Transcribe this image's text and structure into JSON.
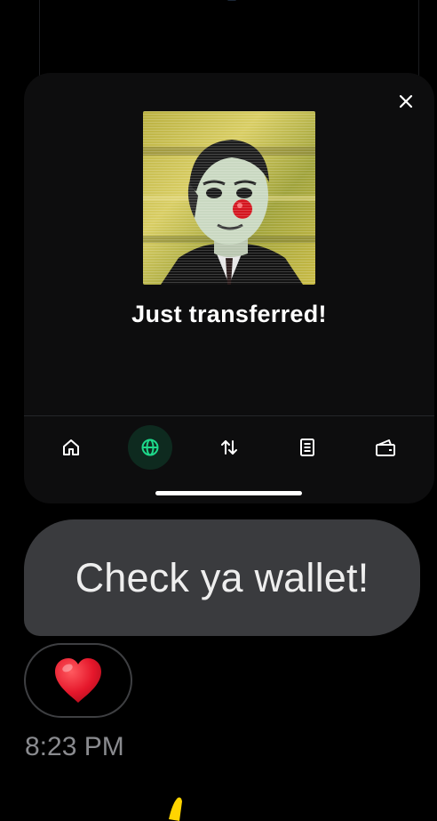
{
  "notification_card": {
    "close_icon": "close-icon",
    "image_alt": "NFT artwork of a man in a suit with a red clown nose",
    "title": "Just transferred!"
  },
  "bottom_nav": {
    "items": [
      {
        "icon": "home-icon",
        "active": false
      },
      {
        "icon": "globe-icon",
        "active": true
      },
      {
        "icon": "transfer-arrows-icon",
        "active": false
      },
      {
        "icon": "document-icon",
        "active": false
      },
      {
        "icon": "wallet-icon",
        "active": false
      }
    ],
    "active_color": "#1ed88a"
  },
  "message": {
    "text": "Check ya wallet!",
    "reaction": "❤️",
    "timestamp": "8:23 PM"
  },
  "colors": {
    "bubble": "#3a3b3e",
    "accent_green": "#1ed88a",
    "reaction_heart": "#e5172b",
    "partial_emoji": "#ffd400"
  }
}
